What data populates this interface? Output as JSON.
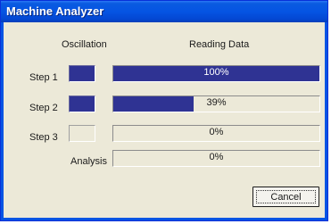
{
  "window": {
    "title": "Machine Analyzer"
  },
  "headers": {
    "oscillation": "Oscillation",
    "reading_data": "Reading Data"
  },
  "steps": [
    {
      "label": "Step 1",
      "oscillation_active": true,
      "progress": 100,
      "progress_text": "100%"
    },
    {
      "label": "Step 2",
      "oscillation_active": true,
      "progress": 39,
      "progress_text": "39%"
    },
    {
      "label": "Step 3",
      "oscillation_active": false,
      "progress": 0,
      "progress_text": "0%"
    }
  ],
  "analysis": {
    "label": "Analysis",
    "progress": 0,
    "progress_text": "0%"
  },
  "buttons": {
    "cancel_label": "Cancel"
  },
  "colors": {
    "progress_fill": "#2f3393",
    "title_bar": "#0554e3",
    "dialog_bg": "#ece9d8"
  }
}
